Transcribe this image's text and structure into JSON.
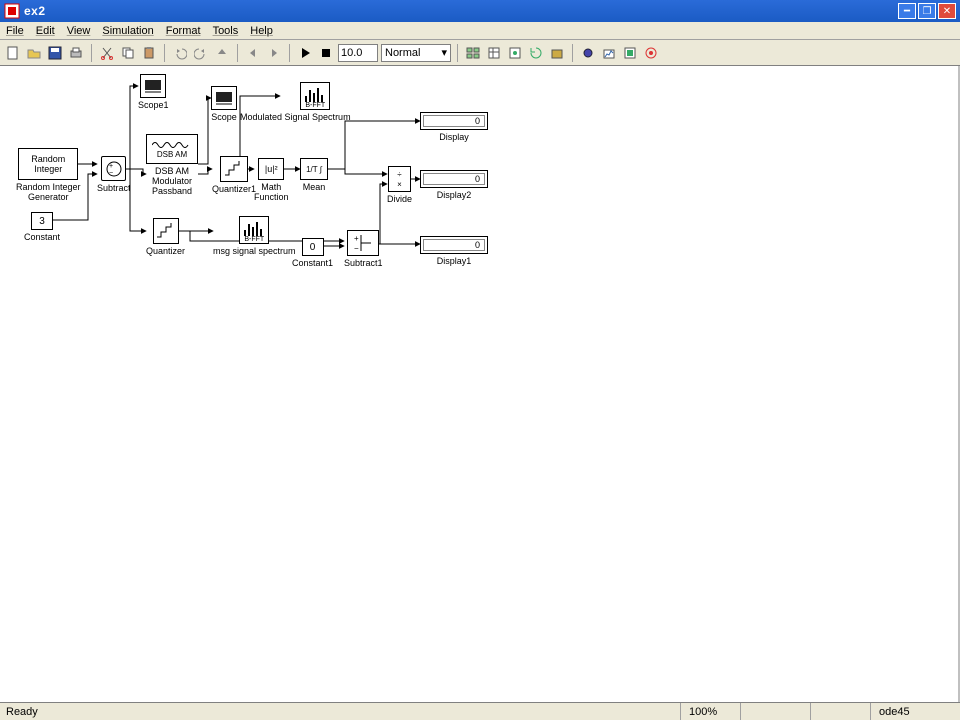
{
  "window": {
    "title": "ex2"
  },
  "menu": [
    "File",
    "Edit",
    "View",
    "Simulation",
    "Format",
    "Tools",
    "Help"
  ],
  "toolbar": {
    "sim_time": "10.0",
    "sim_mode": "Normal"
  },
  "blocks": {
    "scope1": "Scope1",
    "scope": "Scope",
    "mod_spec": "Modulated Signal Spectrum",
    "mod_spec_glyph": "B-FFT",
    "rand_int_l1": "Random",
    "rand_int_l2": "Integer",
    "rand_int_gen": "Random Integer\nGenerator",
    "subtract": "Subtract",
    "dsb_am_top": "DSB AM",
    "dsb_am_l1": "DSB AM",
    "dsb_am_l2": "Modulator",
    "dsb_am_l3": "Passband",
    "quantizer1": "Quantizer1",
    "math_fn_sym": "|u|²",
    "math_fn": "Math\nFunction",
    "mean_sym": "1/T ∫",
    "mean": "Mean",
    "divide": "Divide",
    "display": "Display",
    "display_val": "0",
    "display2": "Display2",
    "display2_val": "0",
    "constant_val": "3",
    "constant": "Constant",
    "quantizer": "Quantizer",
    "msg_spec_glyph": "B-FFT",
    "msg_spec": "msg signal spectrum",
    "constant1_val": "0",
    "constant1": "Constant1",
    "subtract1": "Subtract1",
    "display1": "Display1",
    "display1_val": "0"
  },
  "status": {
    "ready": "Ready",
    "zoom": "100%",
    "solver": "ode45"
  }
}
